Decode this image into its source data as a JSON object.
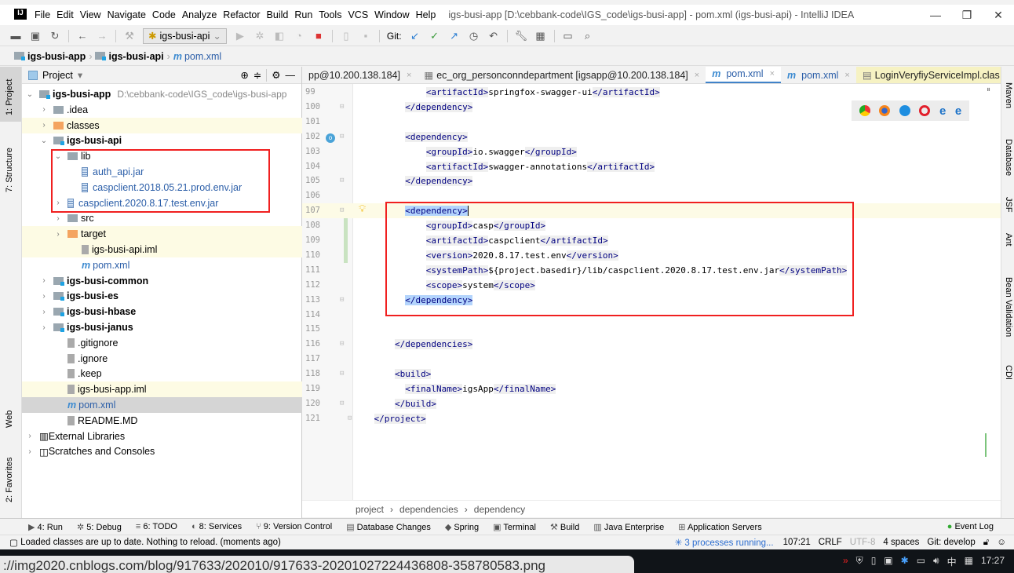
{
  "window": {
    "title": "igs-busi-app [D:\\cebbank-code\\IGS_code\\igs-busi-app] - pom.xml (igs-busi-api) - IntelliJ IDEA",
    "logo": "IJ"
  },
  "menu": [
    "File",
    "Edit",
    "View",
    "Navigate",
    "Code",
    "Analyze",
    "Refactor",
    "Build",
    "Run",
    "Tools",
    "VCS",
    "Window",
    "Help"
  ],
  "toolbar": {
    "run_config": "igs-busi-api",
    "git_label": "Git:"
  },
  "navbar": [
    "igs-busi-app",
    "igs-busi-api",
    "pom.xml"
  ],
  "left_strip": [
    "1: Project",
    "7: Structure",
    "Web",
    "2: Favorites"
  ],
  "right_strip": [
    "Maven",
    "Database",
    "JSF",
    "Ant",
    "Bean Validation",
    "CDI"
  ],
  "project_panel": {
    "title": "Project",
    "tree": [
      {
        "label": "igs-busi-app",
        "extra": "D:\\cebbank-code\\IGS_code\\igs-busi-app",
        "level": 0,
        "arrow": "v",
        "icon": "module",
        "bold": true
      },
      {
        "label": ".idea",
        "level": 1,
        "arrow": ">",
        "icon": "folder"
      },
      {
        "label": "classes",
        "level": 1,
        "arrow": ">",
        "icon": "folder-orange",
        "yellow": true
      },
      {
        "label": "igs-busi-api",
        "level": 1,
        "arrow": "v",
        "icon": "module",
        "bold": true
      },
      {
        "label": "lib",
        "level": 2,
        "arrow": "v",
        "icon": "folder"
      },
      {
        "label": "auth_api.jar",
        "level": 3,
        "arrow": "",
        "icon": "jar",
        "blue": true
      },
      {
        "label": "caspclient.2018.05.21.prod.env.jar",
        "level": 3,
        "arrow": "",
        "icon": "jar",
        "blue": true
      },
      {
        "label": "caspclient.2020.8.17.test.env.jar",
        "level": 2,
        "arrow": ">",
        "icon": "jar",
        "blue": true
      },
      {
        "label": "src",
        "level": 2,
        "arrow": ">",
        "icon": "folder"
      },
      {
        "label": "target",
        "level": 2,
        "arrow": ">",
        "icon": "folder-orange",
        "yellow": true
      },
      {
        "label": "igs-busi-api.iml",
        "level": 3,
        "arrow": "",
        "icon": "file",
        "yellow": true
      },
      {
        "label": "pom.xml",
        "level": 3,
        "arrow": "",
        "icon": "maven",
        "blue": true
      },
      {
        "label": "igs-busi-common",
        "level": 1,
        "arrow": ">",
        "icon": "module",
        "bold": true
      },
      {
        "label": "igs-busi-es",
        "level": 1,
        "arrow": ">",
        "icon": "module",
        "bold": true
      },
      {
        "label": "igs-busi-hbase",
        "level": 1,
        "arrow": ">",
        "icon": "module",
        "bold": true
      },
      {
        "label": "igs-busi-janus",
        "level": 1,
        "arrow": ">",
        "icon": "module",
        "bold": true
      },
      {
        "label": ".gitignore",
        "level": 2,
        "arrow": "",
        "icon": "file"
      },
      {
        "label": ".ignore",
        "level": 2,
        "arrow": "",
        "icon": "file"
      },
      {
        "label": ".keep",
        "level": 2,
        "arrow": "",
        "icon": "file"
      },
      {
        "label": "igs-busi-app.iml",
        "level": 2,
        "arrow": "",
        "icon": "file",
        "yellow": true
      },
      {
        "label": "pom.xml",
        "level": 2,
        "arrow": "",
        "icon": "maven",
        "blue": true,
        "selected": true
      },
      {
        "label": "README.MD",
        "level": 2,
        "arrow": "",
        "icon": "file"
      },
      {
        "label": "External Libraries",
        "level": 0,
        "arrow": ">",
        "icon": "lib"
      },
      {
        "label": "Scratches and Consoles",
        "level": 0,
        "arrow": ">",
        "icon": "scratch"
      }
    ]
  },
  "tabs": [
    {
      "label": "pp@10.200.138.184]",
      "icon": ""
    },
    {
      "label": "ec_org_personconndepartment [igsapp@10.200.138.184]",
      "icon": "table"
    },
    {
      "label": "pom.xml",
      "icon": "maven",
      "active": true
    },
    {
      "label": "pom.xml",
      "icon": "maven"
    },
    {
      "label": "LoginVeryfiyServiceImpl.clas",
      "icon": "class",
      "yellow": true
    }
  ],
  "tabs_overflow": "6",
  "editor": {
    "lines": [
      {
        "n": "99",
        "i": 2,
        "p": [
          [
            "t",
            "<artifactId>"
          ],
          [
            "x",
            "springfox-swagger-ui"
          ],
          [
            "t",
            "</artifactId>"
          ]
        ]
      },
      {
        "n": "100",
        "i": 1,
        "p": [
          [
            "t",
            "</dependency>"
          ]
        ]
      },
      {
        "n": "101",
        "i": 0,
        "p": []
      },
      {
        "n": "102",
        "i": 1,
        "p": [
          [
            "t",
            "<dependency>"
          ]
        ]
      },
      {
        "n": "103",
        "i": 2,
        "p": [
          [
            "t",
            "<groupId>"
          ],
          [
            "x",
            "io.swagger"
          ],
          [
            "t",
            "</groupId>"
          ]
        ]
      },
      {
        "n": "104",
        "i": 2,
        "p": [
          [
            "t",
            "<artifactId>"
          ],
          [
            "x",
            "swagger-annotations"
          ],
          [
            "t",
            "</artifactId>"
          ]
        ]
      },
      {
        "n": "105",
        "i": 1,
        "p": [
          [
            "t",
            "</dependency>"
          ]
        ]
      },
      {
        "n": "106",
        "i": 0,
        "p": []
      },
      {
        "n": "107",
        "i": 1,
        "p": [
          [
            "h",
            "<dependency>"
          ]
        ],
        "cur": true
      },
      {
        "n": "108",
        "i": 2,
        "p": [
          [
            "t",
            "<groupId>"
          ],
          [
            "x",
            "casp"
          ],
          [
            "t",
            "</groupId>"
          ]
        ]
      },
      {
        "n": "109",
        "i": 2,
        "p": [
          [
            "t",
            "<artifactId>"
          ],
          [
            "x",
            "caspclient"
          ],
          [
            "t",
            "</artifactId>"
          ]
        ]
      },
      {
        "n": "110",
        "i": 2,
        "p": [
          [
            "t",
            "<version>"
          ],
          [
            "x",
            "2020.8.17.test.env"
          ],
          [
            "t",
            "</version>"
          ]
        ]
      },
      {
        "n": "111",
        "i": 2,
        "p": [
          [
            "t",
            "<systemPath>"
          ],
          [
            "x",
            "${project.basedir}/lib/caspclient.2020.8.17.test.env.jar"
          ],
          [
            "t",
            "</systemPath>"
          ]
        ]
      },
      {
        "n": "112",
        "i": 2,
        "p": [
          [
            "t",
            "<scope>"
          ],
          [
            "x",
            "system"
          ],
          [
            "t",
            "</scope>"
          ]
        ]
      },
      {
        "n": "113",
        "i": 1,
        "p": [
          [
            "h",
            "</dependency>"
          ]
        ]
      },
      {
        "n": "114",
        "i": 0,
        "p": []
      },
      {
        "n": "115",
        "i": 0,
        "p": []
      },
      {
        "n": "116",
        "i": 0.5,
        "p": [
          [
            "t",
            "</dependencies>"
          ]
        ]
      },
      {
        "n": "117",
        "i": 0,
        "p": []
      },
      {
        "n": "118",
        "i": 0.5,
        "p": [
          [
            "t",
            "<build>"
          ]
        ]
      },
      {
        "n": "119",
        "i": 1,
        "p": [
          [
            "t",
            "<finalName>"
          ],
          [
            "x",
            "igsApp"
          ],
          [
            "t",
            "</finalName>"
          ]
        ]
      },
      {
        "n": "120",
        "i": 0.5,
        "p": [
          [
            "t",
            "</build>"
          ]
        ]
      },
      {
        "n": "121",
        "i": -0.5,
        "p": [
          [
            "t",
            "</project>"
          ]
        ]
      }
    ]
  },
  "breadcrumb": [
    "project",
    "dependencies",
    "dependency"
  ],
  "tool_windows": [
    "4: Run",
    "5: Debug",
    "6: TODO",
    "8: Services",
    "9: Version Control",
    "Database Changes",
    "Spring",
    "Terminal",
    "Build",
    "Java Enterprise",
    "Application Servers"
  ],
  "event_log": "Event Log",
  "status": {
    "message": "Loaded classes are up to date. Nothing to reload. (moments ago)",
    "processes": "3 processes running...",
    "position": "107:21",
    "line_sep": "CRLF",
    "encoding": "UTF-8",
    "indent": "4 spaces",
    "git": "Git: develop"
  },
  "taskbar": {
    "url": "://img2020.cnblogs.com/blog/917633/202010/917633-20201027224436808-358780583.png",
    "time": "17:27",
    "ime": "中"
  },
  "colors": {
    "tag": "#000080",
    "accent": "#4083c9",
    "highlight_box": "#f02020",
    "selection": "#b3d4fc"
  }
}
